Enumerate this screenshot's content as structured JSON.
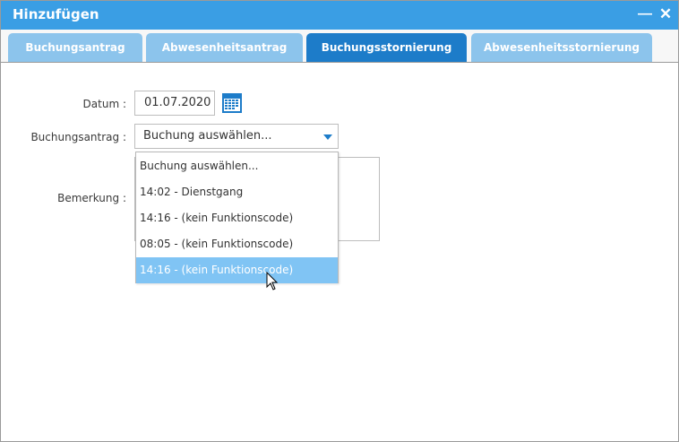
{
  "window": {
    "title": "Hinzufügen",
    "minimize_symbol": "—",
    "close_symbol": "✕"
  },
  "tabs": [
    {
      "label": "Buchungsantrag",
      "active": false
    },
    {
      "label": "Abwesenheitsantrag",
      "active": false
    },
    {
      "label": "Buchungsstornierung",
      "active": true
    },
    {
      "label": "Abwesenheitsstornierung",
      "active": false
    }
  ],
  "form": {
    "datum_label": "Datum :",
    "datum_value": "01.07.2020",
    "buchungsantrag_label": "Buchungsantrag :",
    "buchungsantrag_value": "Buchung auswählen...",
    "bemerkung_label": "Bemerkung :"
  },
  "dropdown": {
    "options": [
      "Buchung auswählen...",
      "14:02 - Dienstgang",
      "14:16 - (kein Funktionscode)",
      "08:05 - (kein Funktionscode)",
      "14:16 - (kein Funktionscode)"
    ],
    "highlighted_index": 4
  },
  "icons": {
    "calendar": "calendar-icon",
    "dropdown_arrow": "chevron-down-icon",
    "cursor": "mouse-pointer-icon"
  },
  "colors": {
    "titlebar": "#3a9ee4",
    "tab_active": "#1d7cc9",
    "tab_inactive": "#8cc4ec",
    "option_highlight": "#80c4f4"
  }
}
